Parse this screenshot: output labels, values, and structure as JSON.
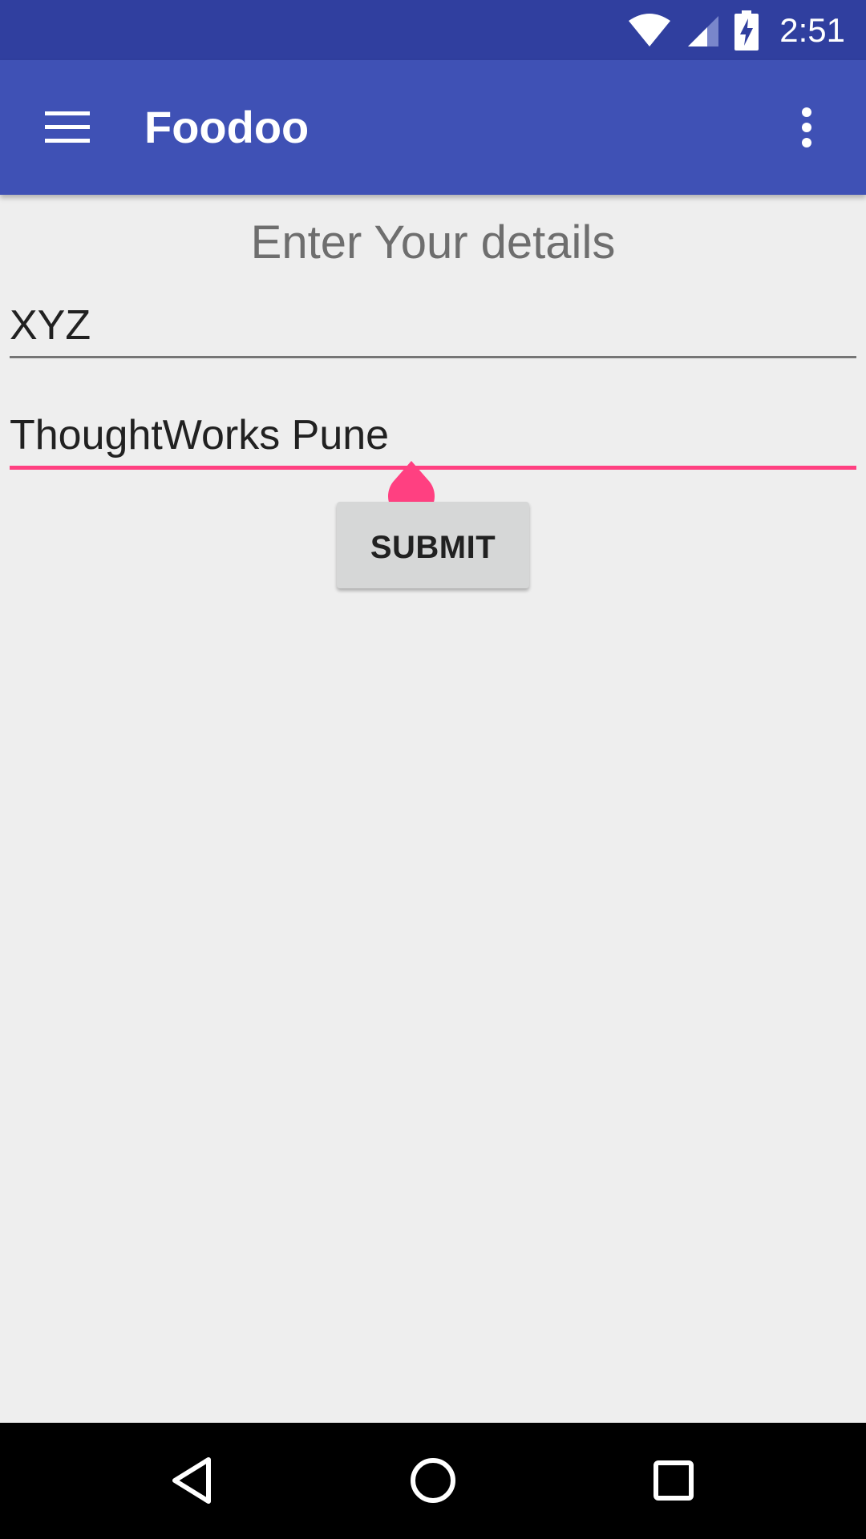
{
  "status_bar": {
    "time": "2:51",
    "icons": [
      "wifi-icon",
      "cell-signal-icon",
      "battery-charging-icon"
    ]
  },
  "app_bar": {
    "title": "Foodoo",
    "menu_icon": "hamburger-menu-icon",
    "overflow_icon": "more-vert-icon"
  },
  "form": {
    "heading": "Enter Your details",
    "name_value": "XYZ",
    "address_value": "ThoughtWorks Pune",
    "submit_label": "SUBMIT"
  },
  "nav_bar": {
    "icons": [
      "back-icon",
      "home-icon",
      "recents-icon"
    ]
  },
  "colors": {
    "status_bar": "#303f9f",
    "app_bar": "#3f51b5",
    "accent": "#ff4081",
    "background": "#eeeeee"
  }
}
